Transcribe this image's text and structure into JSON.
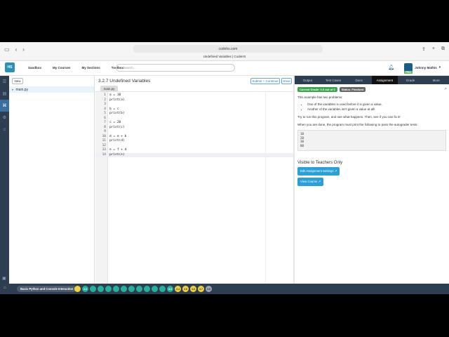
{
  "browser": {
    "url": "codehs.com",
    "tab_title": "Undefined Variables | CodeHS"
  },
  "header": {
    "logo_text": "CodeHS",
    "nav": [
      "Sandbox",
      "My Courses",
      "My Sections",
      "Toolbox"
    ],
    "search_placeholder": "Search...",
    "user_name": "Johnny Mathis",
    "pro_label": "PRO"
  },
  "files": {
    "new_label": "New",
    "items": [
      "main.py"
    ]
  },
  "editor": {
    "title": "3.2.7 Undefined Variables",
    "submit_label": "Submit + Continue",
    "save_label": "Save",
    "file_tab": "main.py",
    "lines": [
      "a = 10",
      "print(a)",
      "",
      "b = c",
      "print(b)",
      "",
      "c = 20",
      "print(c)",
      "",
      "d = e + b",
      "print(d)",
      "",
      "e = f + d",
      "print(e)"
    ],
    "current_line": 14
  },
  "right_panel": {
    "tabs": [
      "Output",
      "Test Cases",
      "Docs",
      "Assignment",
      "Grade",
      "More"
    ],
    "active_tab": "Assignment",
    "grade_badge": "Current Grade: 0.0 out of 0",
    "status_badge": "Status: Finalized",
    "intro": "This example has two problems:",
    "bullets": [
      "One of the variables is used before it is given a value.",
      "Another of the variables isn't given a value at all!"
    ],
    "instructions": "Try to run this program, and see what happens. Then, see if you can fix it!",
    "autograder_text": "When you are done, the program must print the following to pass the autograder tests:",
    "expected_output": [
      "10",
      "20",
      "30",
      "80"
    ],
    "teachers_heading": "Visible to Teachers Only",
    "edit_settings_label": "Edit Assignment Settings",
    "view_course_label": "View Course"
  },
  "bottom_bar": {
    "course_name": "Basic Python and Console Interaction",
    "dots": [
      {
        "label": "",
        "color": "y"
      },
      {
        "label": "2.2",
        "color": "g"
      },
      {
        "label": "",
        "color": "g"
      },
      {
        "label": "",
        "color": "g"
      },
      {
        "label": "",
        "color": "g"
      },
      {
        "label": "",
        "color": "g"
      },
      {
        "label": "",
        "color": "g"
      },
      {
        "label": "",
        "color": "g"
      },
      {
        "label": "",
        "color": "g"
      },
      {
        "label": "",
        "color": "g"
      },
      {
        "label": "",
        "color": "g"
      },
      {
        "label": "",
        "color": "g"
      },
      {
        "label": "3.3",
        "color": "g"
      },
      {
        "label": "3.4",
        "color": "y"
      },
      {
        "label": "3.5",
        "color": "y"
      },
      {
        "label": "3.6",
        "color": "y"
      },
      {
        "label": "3.7",
        "color": "y"
      },
      {
        "label": "3.8",
        "color": "gr"
      }
    ]
  },
  "colors": {
    "accent": "#2aa0d8",
    "rail": "#2d3e50",
    "grade_green": "#3aa54a"
  }
}
